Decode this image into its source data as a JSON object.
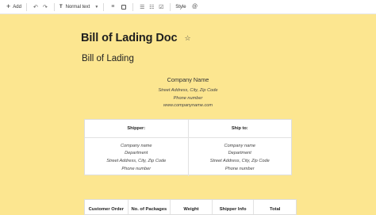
{
  "toolbar": {
    "add_label": "Add",
    "text_style": "Normal text",
    "style_label": "Style"
  },
  "document": {
    "title": "Bill of Lading Doc",
    "heading": "Bill of Lading"
  },
  "company": {
    "name": "Company Name",
    "address": "Street Address, City, Zip Code",
    "phone": "Phone number",
    "website": "www.companyname.com"
  },
  "ship_table": {
    "shipper_header": "Shipper:",
    "ship_to_header": "Ship to:",
    "shipper_lines": [
      "Company name",
      "Department",
      "Street Address, City, Zip Code",
      "Phone number"
    ],
    "ship_to_lines": [
      "Company name",
      "Department",
      "Street Address, City, Zip Code",
      "Phone number"
    ]
  },
  "order_table": {
    "headers": [
      "Customer Order",
      "No. of Packages",
      "Weight",
      "Shipper Info",
      "Total"
    ]
  }
}
